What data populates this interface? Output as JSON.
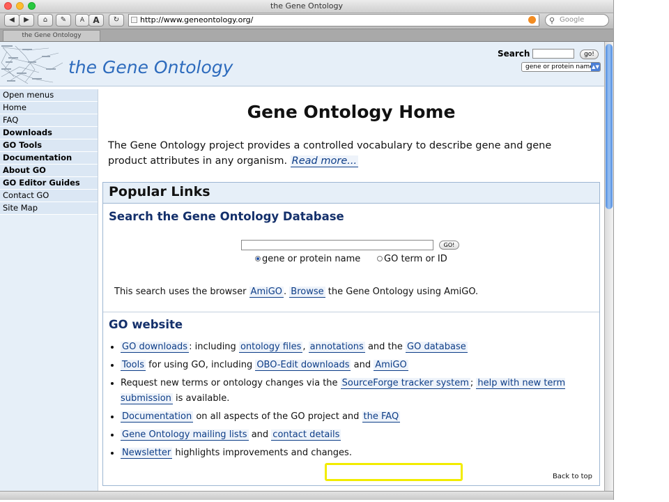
{
  "window": {
    "title": "the Gene Ontology"
  },
  "toolbar": {
    "back_icon": "back-arrow-icon",
    "forward_icon": "forward-arrow-icon",
    "home_icon": "home-icon",
    "edit_icon": "pencil-icon",
    "text_small": "A",
    "text_large": "A",
    "reload_icon": "reload-icon",
    "url": "http://www.geneontology.org/",
    "search_placeholder": "Google"
  },
  "tab": {
    "label": "the Gene Ontology"
  },
  "header": {
    "logo_text": "the Gene Ontology",
    "search_label": "Search",
    "search_go": "go!",
    "search_type": "gene or protein name"
  },
  "sidebar": {
    "items": [
      {
        "label": "Open menus",
        "bold": false
      },
      {
        "label": "Home",
        "bold": false
      },
      {
        "label": "FAQ",
        "bold": false
      },
      {
        "label": "Downloads",
        "bold": true
      },
      {
        "label": "GO Tools",
        "bold": true
      },
      {
        "label": "Documentation",
        "bold": true
      },
      {
        "label": "About GO",
        "bold": true
      },
      {
        "label": "GO Editor Guides",
        "bold": true
      },
      {
        "label": "Contact GO",
        "bold": false
      },
      {
        "label": "Site Map",
        "bold": false
      }
    ]
  },
  "main": {
    "title": "Gene Ontology Home",
    "intro_text": "The Gene Ontology project provides a controlled vocabulary to describe gene and gene product attributes in any organism. ",
    "read_more": "Read more...",
    "popular_links": "Popular Links",
    "search_db": {
      "heading": "Search the Gene Ontology Database",
      "go_label": "GO!",
      "radio_gene": "gene or protein name",
      "radio_term": "GO term or ID",
      "note_1": "This search uses the browser ",
      "amigo": "AmiGO",
      "note_2": ". ",
      "browse": "Browse",
      "note_3": " the Gene Ontology using AmiGO."
    },
    "go_website": {
      "heading": "GO website",
      "item1": {
        "link1": "GO downloads",
        "t1": ": including ",
        "link2": "ontology files",
        "t2": ", ",
        "link3": "annotations",
        "t3": " and the ",
        "link4": "GO database"
      },
      "item2": {
        "link1": "Tools",
        "t1": " for using GO, including ",
        "link2": "OBO-Edit downloads",
        "t2": " and ",
        "link3": "AmiGO"
      },
      "item3": {
        "t1": "Request new terms or ontology changes via the ",
        "link1": "SourceForge tracker system",
        "t2": "; ",
        "link2": "help with new term submission",
        "t3": " is available."
      },
      "item4": {
        "link1": "Documentation",
        "t1": " on all aspects of the GO project and ",
        "link2": "the FAQ"
      },
      "item5": {
        "link1": "Gene Ontology mailing lists",
        "t1": " and ",
        "link2": "contact details"
      },
      "item6": {
        "link1": "Newsletter",
        "t1": " highlights improvements and changes."
      }
    },
    "back_to_top": "Back to top"
  }
}
